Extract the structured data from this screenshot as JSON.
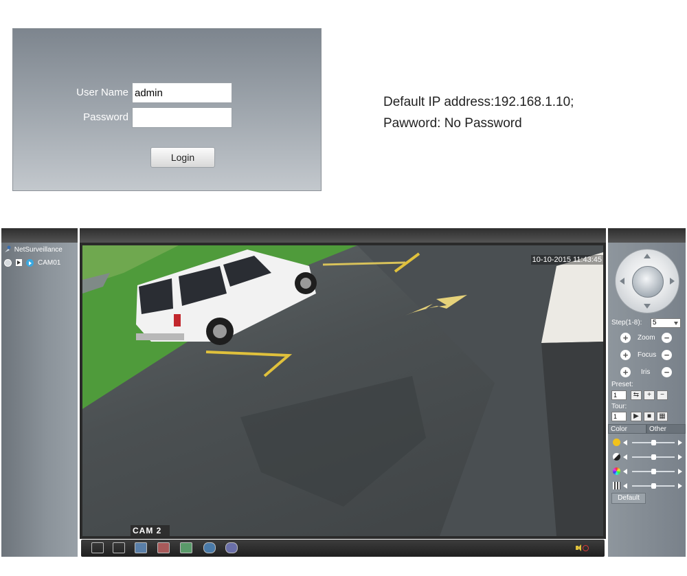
{
  "login": {
    "username_label": "User Name",
    "username_value": "admin",
    "password_label": "Password",
    "password_value": "",
    "login_button": "Login"
  },
  "info": {
    "line1": "Default IP address:192.168.1.10;",
    "line2": "Pawword: No Password"
  },
  "sidebar": {
    "root_label": "NetSurveillance",
    "camera_label": "CAM01"
  },
  "video": {
    "timestamp": "10-10-2015 11:43:45",
    "cam_label": "CAM 2"
  },
  "ptz": {
    "step_label": "Step(1-8):",
    "step_value": "5",
    "zoom_label": "Zoom",
    "focus_label": "Focus",
    "iris_label": "Iris",
    "preset_label": "Preset:",
    "preset_value": "1",
    "tour_label": "Tour:",
    "tour_value": "1",
    "tab_color": "Color",
    "tab_other": "Other",
    "default_button": "Default"
  },
  "image_settings": {
    "brightness": 0.5,
    "contrast": 0.5,
    "saturation": 0.5,
    "hue": 0.5
  },
  "colors": {
    "panel_header": "#2e2e2e",
    "play_icon": "#3aa8e0",
    "mute_icon": "#e03a3a"
  },
  "icons": [
    "user-icon",
    "record-icon",
    "play-icon",
    "camera-icon",
    "fullscreen-icon",
    "single-view-icon",
    "record-start-icon",
    "record-stop-icon",
    "snapshot-icon",
    "talk-icon",
    "playback-icon",
    "speaker-muted-icon"
  ]
}
